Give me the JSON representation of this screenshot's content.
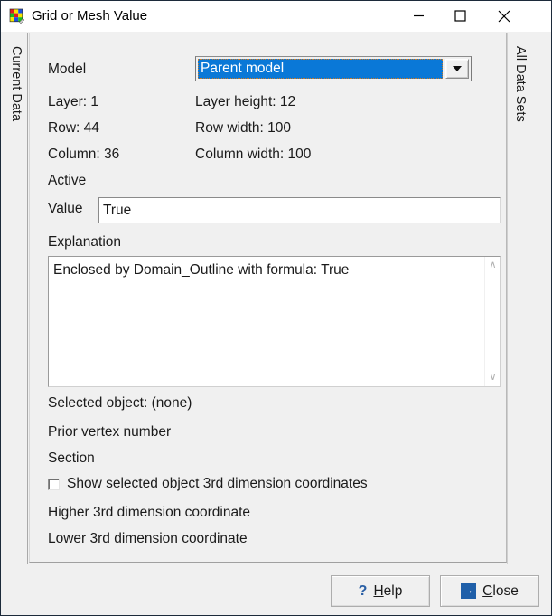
{
  "window": {
    "title": "Grid or Mesh Value",
    "icon": "grid-mesh-icon",
    "minimize_label": "─",
    "maximize_label": "□",
    "close_label": "✕"
  },
  "tabs": {
    "left": "Current Data",
    "right": "All Data Sets"
  },
  "form": {
    "model_label": "Model",
    "model_value": "Parent model",
    "dropdown_icon": "chevron-down-icon",
    "layer_label": "Layer: 1",
    "layer_height_label": "Layer height: 12",
    "row_label": "Row: 44",
    "row_width_label": "Row width: 100",
    "column_label": "Column: 36",
    "column_width_label": "Column width: 100",
    "active_label": "Active",
    "value_label": "Value",
    "value_text": "True",
    "explanation_label": "Explanation",
    "explanation_text": "Enclosed by Domain_Outline with formula: True",
    "scroll_up_icon": "∧",
    "scroll_down_icon": "∨",
    "selected_object_label": "Selected object: (none)",
    "prior_vertex_label": "Prior vertex number",
    "section_label": "Section",
    "show_3d_checkbox_label": "Show selected object 3rd dimension coordinates",
    "show_3d_checked": false,
    "higher_3d_label": "Higher 3rd dimension coordinate",
    "lower_3d_label": "Lower 3rd dimension coordinate"
  },
  "buttons": {
    "help_icon": "?",
    "help_prefix": "H",
    "help_suffix": "elp",
    "close_icon": "→",
    "close_prefix": "C",
    "close_suffix": "lose"
  },
  "colors": {
    "accent_blue": "#0a78d7",
    "icon_blue": "#1f5fa9",
    "dialog_bg": "#f0f0f0"
  }
}
